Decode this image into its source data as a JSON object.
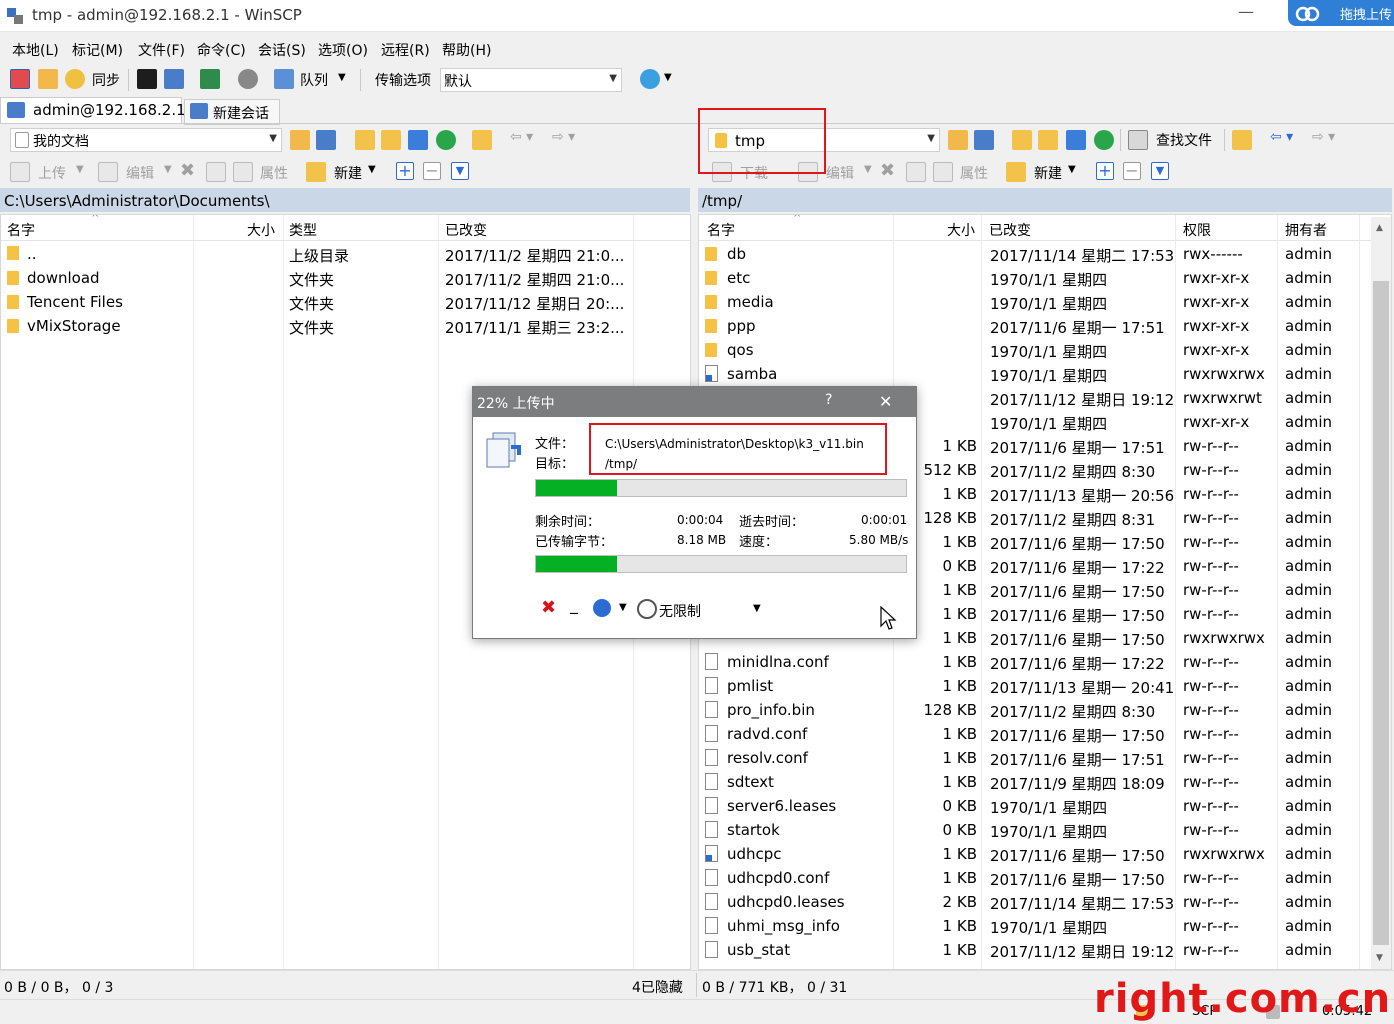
{
  "window": {
    "title": "tmp - admin@192.168.2.1 - WinSCP",
    "minimize": "—"
  },
  "baidu": {
    "label": "拖拽上传"
  },
  "menu": [
    "本地(L)",
    "标记(M)",
    "文件(F)",
    "命令(C)",
    "会话(S)",
    "选项(O)",
    "远程(R)",
    "帮助(H)"
  ],
  "toolbar": {
    "sync": "同步",
    "queue": "队列",
    "transfer_options": "传输选项",
    "transfer_preset": "默认"
  },
  "sessions": {
    "active": "admin@192.168.2.1",
    "new": "新建会话"
  },
  "local": {
    "location": "我的文档",
    "actions": {
      "upload": "上传",
      "edit": "编辑",
      "properties": "属性",
      "new": "新建"
    },
    "path": "C:\\Users\\Administrator\\Documents\\",
    "columns": [
      "名字",
      "大小",
      "类型",
      "已改变"
    ],
    "rows": [
      {
        "name": "..",
        "size": "",
        "type": "上级目录",
        "changed": "2017/11/2 星期四 21:0...",
        "icon": "updir"
      },
      {
        "name": "download",
        "size": "",
        "type": "文件夹",
        "changed": "2017/11/2 星期四 21:0...",
        "icon": "folder"
      },
      {
        "name": "Tencent Files",
        "size": "",
        "type": "文件夹",
        "changed": "2017/11/12 星期日 20:...",
        "icon": "folder"
      },
      {
        "name": "vMixStorage",
        "size": "",
        "type": "文件夹",
        "changed": "2017/11/1 星期三 23:2...",
        "icon": "folder"
      }
    ],
    "status": "0 B / 0 B， 0 / 3",
    "hidden": "4已隐藏"
  },
  "remote": {
    "location": "tmp",
    "find": "查找文件",
    "actions": {
      "download": "下载",
      "edit": "编辑",
      "properties": "属性",
      "new": "新建"
    },
    "path": "/tmp/",
    "columns": [
      "名字",
      "大小",
      "已改变",
      "权限",
      "拥有者"
    ],
    "rows": [
      {
        "name": "db",
        "size": "",
        "changed": "2017/11/14 星期二 17:53",
        "rights": "rwx------",
        "owner": "admin",
        "icon": "folder"
      },
      {
        "name": "etc",
        "size": "",
        "changed": "1970/1/1 星期四",
        "rights": "rwxr-xr-x",
        "owner": "admin",
        "icon": "folder"
      },
      {
        "name": "media",
        "size": "",
        "changed": "1970/1/1 星期四",
        "rights": "rwxr-xr-x",
        "owner": "admin",
        "icon": "folder"
      },
      {
        "name": "ppp",
        "size": "",
        "changed": "2017/11/6 星期一 17:51",
        "rights": "rwxr-xr-x",
        "owner": "admin",
        "icon": "folder"
      },
      {
        "name": "qos",
        "size": "",
        "changed": "1970/1/1 星期四",
        "rights": "rwxr-xr-x",
        "owner": "admin",
        "icon": "folder"
      },
      {
        "name": "samba",
        "size": "",
        "changed": "1970/1/1 星期四",
        "rights": "rwxrwxrwx",
        "owner": "admin",
        "icon": "link"
      },
      {
        "name": "",
        "size": "",
        "changed": "2017/11/12 星期日 19:12",
        "rights": "rwxrwxrwt",
        "owner": "admin",
        "icon": "none"
      },
      {
        "name": "",
        "size": "",
        "changed": "1970/1/1 星期四",
        "rights": "rwxr-xr-x",
        "owner": "admin",
        "icon": "none"
      },
      {
        "name": "",
        "size": "1 KB",
        "changed": "2017/11/6 星期一 17:51",
        "rights": "rw-r--r--",
        "owner": "admin",
        "icon": "none"
      },
      {
        "name": "",
        "size": "512 KB",
        "changed": "2017/11/2 星期四 8:30",
        "rights": "rw-r--r--",
        "owner": "admin",
        "icon": "none"
      },
      {
        "name": "",
        "size": "1 KB",
        "changed": "2017/11/13 星期一 20:56",
        "rights": "rw-r--r--",
        "owner": "admin",
        "icon": "none"
      },
      {
        "name": "",
        "size": "128 KB",
        "changed": "2017/11/2 星期四 8:31",
        "rights": "rw-r--r--",
        "owner": "admin",
        "icon": "none"
      },
      {
        "name": "",
        "size": "1 KB",
        "changed": "2017/11/6 星期一 17:50",
        "rights": "rw-r--r--",
        "owner": "admin",
        "icon": "none"
      },
      {
        "name": "",
        "size": "0 KB",
        "changed": "2017/11/6 星期一 17:22",
        "rights": "rw-r--r--",
        "owner": "admin",
        "icon": "none"
      },
      {
        "name": "",
        "size": "1 KB",
        "changed": "2017/11/6 星期一 17:50",
        "rights": "rw-r--r--",
        "owner": "admin",
        "icon": "none"
      },
      {
        "name": "",
        "size": "1 KB",
        "changed": "2017/11/6 星期一 17:50",
        "rights": "rw-r--r--",
        "owner": "admin",
        "icon": "none"
      },
      {
        "name": "",
        "size": "1 KB",
        "changed": "2017/11/6 星期一 17:50",
        "rights": "rwxrwxrwx",
        "owner": "admin",
        "icon": "none"
      },
      {
        "name": "minidlna.conf",
        "size": "1 KB",
        "changed": "2017/11/6 星期一 17:22",
        "rights": "rw-r--r--",
        "owner": "admin",
        "icon": "file"
      },
      {
        "name": "pmlist",
        "size": "1 KB",
        "changed": "2017/11/13 星期一 20:41",
        "rights": "rw-r--r--",
        "owner": "admin",
        "icon": "file"
      },
      {
        "name": "pro_info.bin",
        "size": "128 KB",
        "changed": "2017/11/2 星期四 8:30",
        "rights": "rw-r--r--",
        "owner": "admin",
        "icon": "file"
      },
      {
        "name": "radvd.conf",
        "size": "1 KB",
        "changed": "2017/11/6 星期一 17:50",
        "rights": "rw-r--r--",
        "owner": "admin",
        "icon": "file"
      },
      {
        "name": "resolv.conf",
        "size": "1 KB",
        "changed": "2017/11/6 星期一 17:51",
        "rights": "rw-r--r--",
        "owner": "admin",
        "icon": "file"
      },
      {
        "name": "sdtext",
        "size": "1 KB",
        "changed": "2017/11/9 星期四 18:09",
        "rights": "rw-r--r--",
        "owner": "admin",
        "icon": "file"
      },
      {
        "name": "server6.leases",
        "size": "0 KB",
        "changed": "1970/1/1 星期四",
        "rights": "rw-r--r--",
        "owner": "admin",
        "icon": "file"
      },
      {
        "name": "startok",
        "size": "0 KB",
        "changed": "1970/1/1 星期四",
        "rights": "rw-r--r--",
        "owner": "admin",
        "icon": "file"
      },
      {
        "name": "udhcpc",
        "size": "1 KB",
        "changed": "2017/11/6 星期一 17:50",
        "rights": "rwxrwxrwx",
        "owner": "admin",
        "icon": "link"
      },
      {
        "name": "udhcpd0.conf",
        "size": "1 KB",
        "changed": "2017/11/6 星期一 17:50",
        "rights": "rw-r--r--",
        "owner": "admin",
        "icon": "file"
      },
      {
        "name": "udhcpd0.leases",
        "size": "2 KB",
        "changed": "2017/11/14 星期二 17:53",
        "rights": "rw-r--r--",
        "owner": "admin",
        "icon": "file"
      },
      {
        "name": "uhmi_msg_info",
        "size": "1 KB",
        "changed": "1970/1/1 星期四",
        "rights": "rw-r--r--",
        "owner": "admin",
        "icon": "file"
      },
      {
        "name": "usb_stat",
        "size": "1 KB",
        "changed": "2017/11/12 星期日 19:12",
        "rights": "rw-r--r--",
        "owner": "admin",
        "icon": "file"
      }
    ],
    "status": "0 B / 771 KB， 0 / 31"
  },
  "dialog": {
    "title": "22% 上传中",
    "help": "?",
    "close": "✕",
    "file_label": "文件：",
    "target_label": "目标：",
    "file_value": "C:\\Users\\Administrator\\Desktop\\k3_v11.bin",
    "target_value": "/tmp/",
    "file_progress": 0.22,
    "total_progress": 0.22,
    "remaining_label": "剩余时间：",
    "remaining_value": "0:00:04",
    "elapsed_label": "逝去时间：",
    "elapsed_value": "0:00:01",
    "bytes_label": "已传输字节：",
    "bytes_value": "8.18 MB",
    "speed_label": "速度：",
    "speed_value": "5.80 MB/s",
    "cancel": "✖",
    "minimize": "_",
    "speed_limit": "无限制"
  },
  "statusbar": {
    "protocol": "SCP",
    "timer": "0:05:42"
  },
  "watermark": "right.com.cn"
}
